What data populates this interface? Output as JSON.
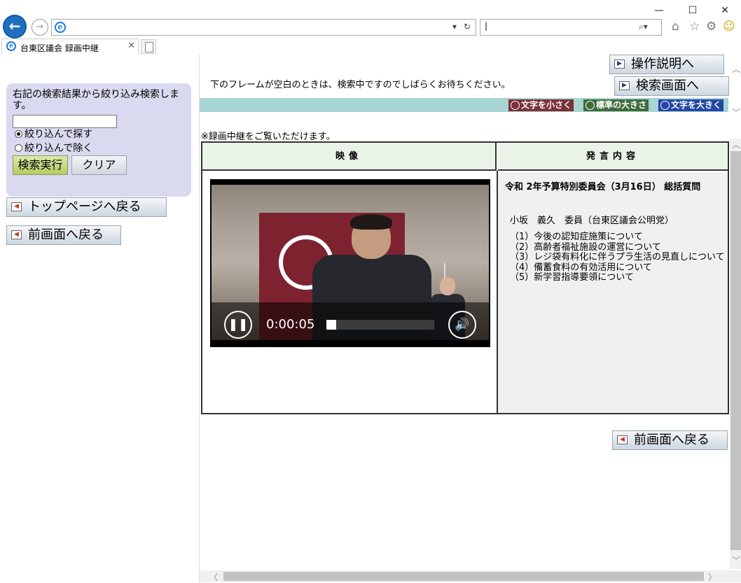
{
  "browser": {
    "tab_title": "台東区議会 録画中継",
    "window_minimize": "—",
    "window_maximize": "☐",
    "window_close": "✕"
  },
  "left_panel": {
    "filter_description": "右記の検索結果から絞り込み検索します。",
    "filter_input_value": "",
    "radio_include": "絞り込んで探す",
    "radio_exclude": "絞り込んで除く",
    "search_button": "検索実行",
    "clear_button": "クリア",
    "top_page_button": "トップページへ戻る",
    "prev_page_button": "前画面へ戻る"
  },
  "right_panel": {
    "manual_button": "操作説明へ",
    "search_screen_button": "検索画面へ",
    "notice": "下のフレームが空白のときは、検索中ですのでしばらくお待ちください。",
    "text_smaller": "文字を小さく",
    "text_standard": "標準の大きさ",
    "text_larger": "文字を大きく",
    "recording_note": "※録画中継をご覧いただけます。",
    "table": {
      "header_video": "映像",
      "header_speech": "発言内容",
      "meeting_title": "令和 2年予算特別委員会（3月16日） 総括質問",
      "speaker": "小坂　義久　委員（台東区議会公明党）",
      "topics": [
        "（1）今後の認知症施策について",
        "（2）高齢者福祉施設の運営について",
        "（3）レジ袋有料化に伴うプラ生活の見直しについて",
        "（4）備蓄食料の有効活用について",
        "（5）新学習指導要領について"
      ]
    },
    "video": {
      "time": "0:00:05",
      "progress": 0.09
    },
    "bottom_back_button": "前画面へ戻る"
  }
}
